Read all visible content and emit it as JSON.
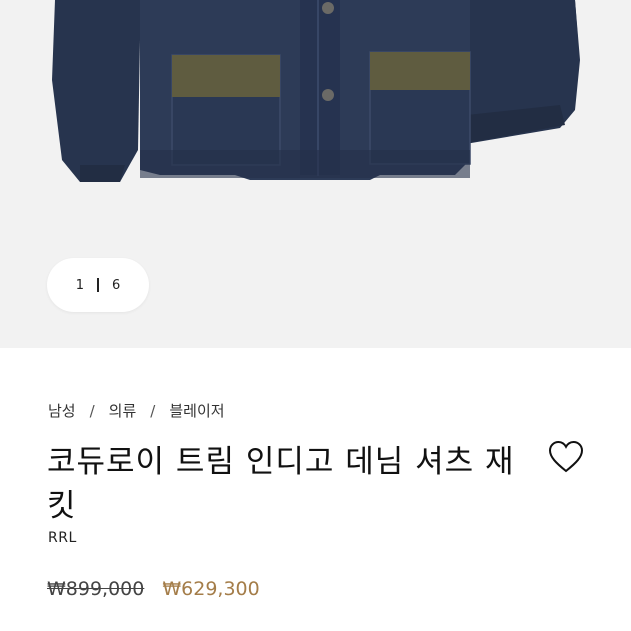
{
  "gallery": {
    "current_index": "1",
    "total": "6"
  },
  "breadcrumb": {
    "items": [
      "남성",
      "의류",
      "블레이저"
    ],
    "separator": "/"
  },
  "product": {
    "title": "코듀로이 트림 인디고 데님 셔츠 재킷",
    "brand": "RRL",
    "original_price": "₩899,000",
    "sale_price": "₩629,300"
  },
  "colors": {
    "hero_background": "#f2f2f2",
    "sale_price": "#a47d49",
    "denim": "#2c3a55",
    "corduroy_trim": "#5f5c40"
  },
  "icons": {
    "wishlist": "heart-outline-icon"
  }
}
